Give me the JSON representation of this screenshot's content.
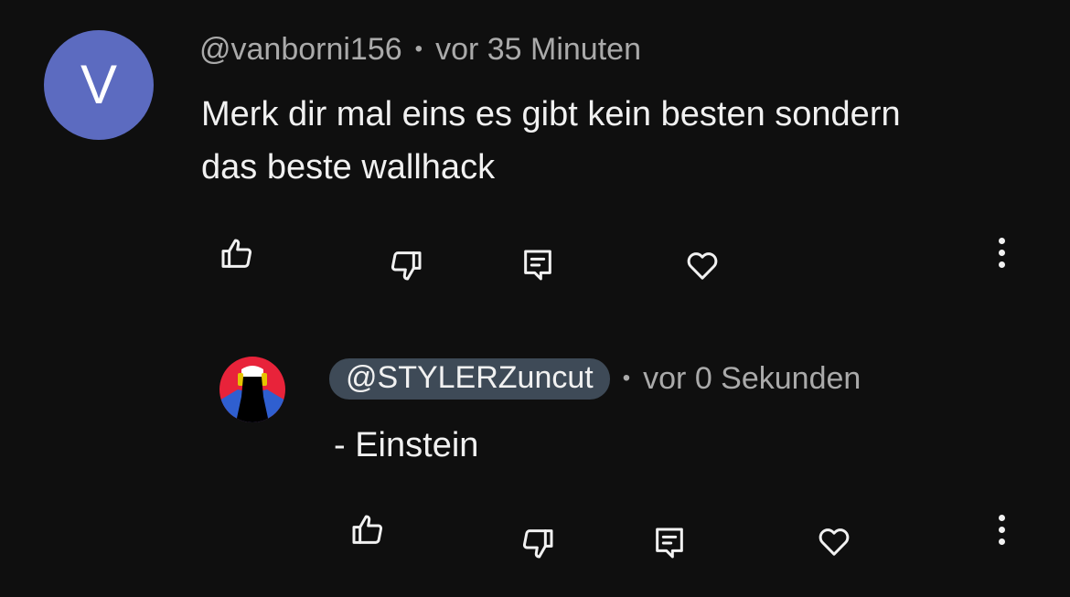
{
  "comment": {
    "avatar_letter": "V",
    "author": "@vanborni156",
    "separator": "•",
    "timestamp": "vor 35 Minuten",
    "text_line1": "Merk dir mal eins es gibt kein besten sondern",
    "text_line2": "das beste wallhack",
    "actions": [
      "thumbs-up-icon",
      "thumbs-down-icon",
      "reply-icon",
      "heart-icon",
      "more-vert-icon"
    ]
  },
  "reply": {
    "author": "@STYLERZuncut",
    "separator": "•",
    "timestamp": "vor 0 Sekunden",
    "text": "- Einstein",
    "actions": [
      "thumbs-up-icon",
      "thumbs-down-icon",
      "reply-icon",
      "heart-icon",
      "more-vert-icon"
    ]
  },
  "colors": {
    "background": "#0f0f0f",
    "avatar_bg": "#5c6bc0",
    "pill_bg": "#3e4a57",
    "secondary_text": "#aaaaaa",
    "primary_text": "#f1f1f1"
  }
}
